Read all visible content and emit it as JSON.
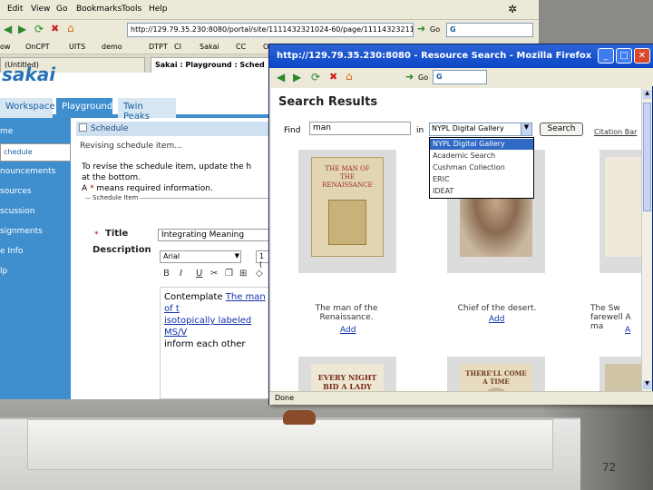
{
  "background_window": {
    "menu": [
      "Edit",
      "View",
      "Go",
      "Bookmarks",
      "Tools",
      "Help"
    ],
    "url": "http://129.79.35.230:8080/portal/site/1111432321024-60/page/1111432321131",
    "go_label": "Go",
    "bookmarks": [
      "ow",
      "OnCPT",
      "UITS",
      "demo",
      "DTPT",
      "CI",
      "Sakai",
      "CC",
      "OnCPT"
    ],
    "tabs": [
      "(Untitled)",
      "Sakai : Playground : Sched"
    ],
    "site_tabs": [
      "Workspace",
      "Playground",
      "Twin Peaks"
    ],
    "left_nav": [
      "me",
      "chedule",
      "nouncements",
      "sources",
      "scussion",
      "signments",
      "e Info",
      "lp"
    ],
    "schedule_title": "Schedule",
    "breadcrumb": "Revising schedule item...",
    "instructions_line1": "To revise the schedule item, update the h",
    "instructions_line2": "at the bottom.",
    "required_note_pre": "A",
    "required_star": "*",
    "required_note_post": "means required information.",
    "fieldset_legend": "Schedule Item",
    "title_label": "Title",
    "title_value": "Integrating Meaning",
    "description_label": "Description",
    "font_name": "Arial",
    "font_size": "1 (",
    "editor_intro": "Contemplate",
    "editor_link1": "The man of t",
    "editor_link2": "isotopically labeled MS/V",
    "editor_tail": "inform each other"
  },
  "popup": {
    "title": "http://129.79.35.230:8080 - Resource Search - Mozilla Firefox",
    "heading": "Search Results",
    "find_label": "Find",
    "search_value": "man",
    "in_label": "in",
    "collection": "NYPL Digital Gallery",
    "search_button": "Search",
    "citation_link": "Citation Bar",
    "dropdown_options": [
      "NYPL Digital Gallery",
      "Academic Search",
      "Cushman Collection",
      "ERIC",
      "IDEAT"
    ],
    "results": [
      {
        "caption": "The man of the Renaissance.",
        "add": "Add"
      },
      {
        "caption": "Chief of the desert.",
        "add": "Add"
      },
      {
        "caption": "The Sw farewell A ma",
        "add": "A"
      }
    ],
    "cover1_title": "THE MAN OF THE RENAISSANCE",
    "sheet1_title": "EVERY NIGHT BID A LADY BUT ME",
    "sheet2_title": "THERE'LL COME A TIME",
    "status": "Done"
  },
  "slide_number": "72"
}
